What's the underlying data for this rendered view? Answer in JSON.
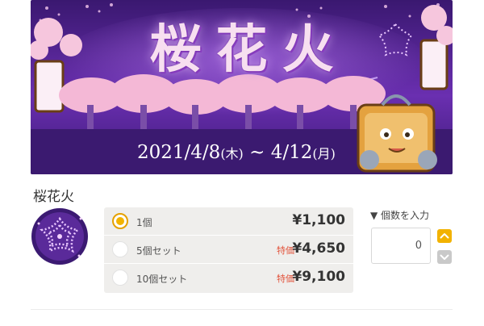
{
  "banner": {
    "title": "桜花火",
    "date_start": "2021/4/8",
    "date_start_day": "(木)",
    "date_separator": " ~ ",
    "date_end": "4/12",
    "date_end_day": "(月)"
  },
  "product": {
    "name": "桜花火"
  },
  "options": [
    {
      "label": "1個",
      "sale": "",
      "price": "¥1,100",
      "selected": true
    },
    {
      "label": "5個セット",
      "sale": "特価",
      "price": "¥4,650",
      "selected": false
    },
    {
      "label": "10個セット",
      "sale": "特価",
      "price": "¥9,100",
      "selected": false
    }
  ],
  "quantity": {
    "label": "▼ 個数を入力",
    "value": "0"
  },
  "colors": {
    "accent": "#f2b300",
    "sale": "#e2533b",
    "banner_bg": "#4a1f86"
  },
  "icons": {
    "thumbnail": "sakura-firework-icon",
    "up": "chevron-up-icon",
    "down": "chevron-down-icon"
  }
}
